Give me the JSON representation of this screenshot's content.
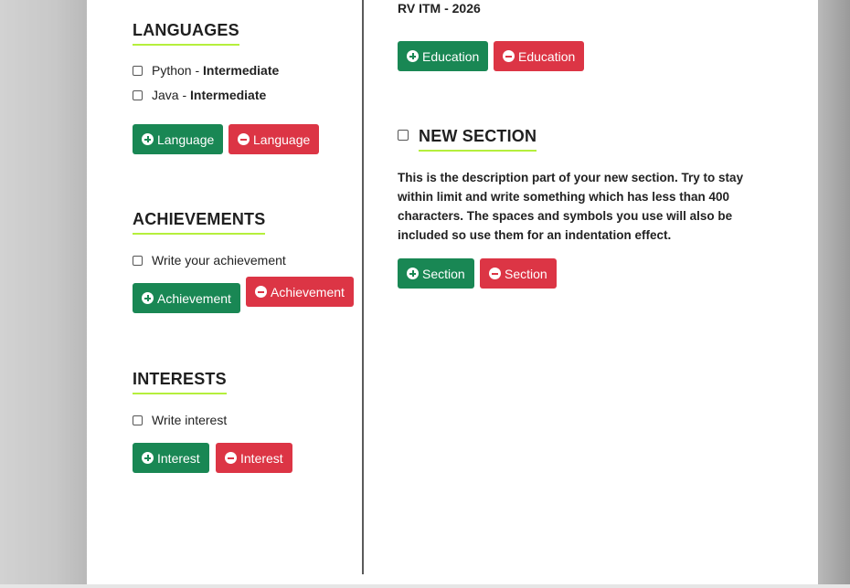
{
  "right": {
    "education_entry": "RV ITM - 2026",
    "education_add": "Education",
    "education_remove": "Education",
    "new_section_title": "NEW SECTION",
    "new_section_description": "This is the description part of your new section. Try to stay within limit and write something which has less than 400 characters. The spaces and symbols you use will also be included so use them for an indentation effect.",
    "section_add": "Section",
    "section_remove": "Section"
  },
  "languages": {
    "title": "LANGUAGES",
    "items": [
      {
        "name": "Python",
        "sep": " - ",
        "level": "Intermediate"
      },
      {
        "name": "Java",
        "sep": " - ",
        "level": "Intermediate"
      }
    ],
    "add_label": "Language",
    "remove_label": "Language"
  },
  "achievements": {
    "title": "ACHIEVEMENTS",
    "items": [
      "Write your achievement"
    ],
    "add_label": "Achievement",
    "remove_label": "Achievement"
  },
  "interests": {
    "title": "INTERESTS",
    "items": [
      "Write interest"
    ],
    "add_label": "Interest",
    "remove_label": "Interest"
  },
  "colors": {
    "accent_underline": "#b5ef3c",
    "add_button": "#198754",
    "remove_button": "#dc3545"
  }
}
